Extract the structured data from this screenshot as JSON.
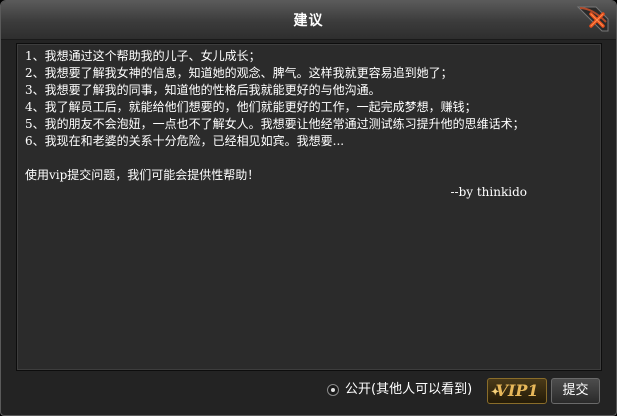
{
  "window": {
    "title": "建议",
    "close_icon": "close-x-icon"
  },
  "content": {
    "lines": [
      "1、我想通过这个帮助我的儿子、女儿成长；",
      "2、我想要了解我女神的信息，知道她的观念、脾气。这样我就更容易追到她了；",
      "3、我想要了解我的同事，知道他的性格后我就能更好的与他沟通。",
      "4、我了解员工后，就能给他们想要的，他们就能更好的工作，一起完成梦想，赚钱；",
      "5、我的朋友不会泡妞，一点也不了解女人。我想要让他经常通过测试练习提升他的思维话术；",
      "6、我现在和老婆的关系十分危险，已经相见如宾。我想要..."
    ],
    "vip_note": "使用vip提交问题，我们可能会提供性帮助！",
    "signature": "--by thinkido"
  },
  "footer": {
    "public_label": "公开(其他人可以看到)",
    "public_checked": true,
    "vip_label": "VIP1",
    "submit_label": "提交"
  },
  "colors": {
    "background": "#232323",
    "text": "#ffffff",
    "vip_gold": "#e8b85a"
  }
}
